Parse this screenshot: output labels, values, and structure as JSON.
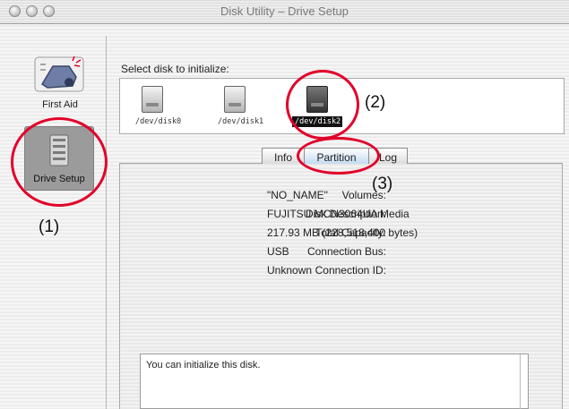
{
  "window": {
    "title": "Disk Utility – Drive Setup"
  },
  "sidebar": {
    "items": [
      {
        "label": "First Aid",
        "icon": "first-aid-icon"
      },
      {
        "label": "Drive Setup",
        "icon": "drive-setup-icon",
        "selected": true
      }
    ]
  },
  "disks": {
    "label": "Select disk to initialize:",
    "items": [
      {
        "name": "/dev/disk0"
      },
      {
        "name": "/dev/disk1"
      },
      {
        "name": "/dev/disk2",
        "selected": true
      }
    ]
  },
  "tabs": [
    {
      "label": "Info"
    },
    {
      "label": "Partition",
      "active": true
    },
    {
      "label": "Log"
    }
  ],
  "info": [
    {
      "key": "Volumes:",
      "value": "\"NO_NAME\""
    },
    {
      "key": "Disk Description:",
      "value": "FUJITSU MCN3064UA Media"
    },
    {
      "key": "Total Capacity:",
      "value": "217.93 MB (228,518,400 bytes)"
    },
    {
      "key": "Connection Bus:",
      "value": "USB"
    },
    {
      "key": "Connection ID:",
      "value": "Unknown"
    }
  ],
  "message": "You can initialize this disk.",
  "callouts": [
    {
      "label": "(1)"
    },
    {
      "label": "(2)"
    },
    {
      "label": "(3)"
    }
  ],
  "colors": {
    "callout": "#e2002a",
    "selection": "#111111",
    "active_tab": "#bcd6f0"
  }
}
